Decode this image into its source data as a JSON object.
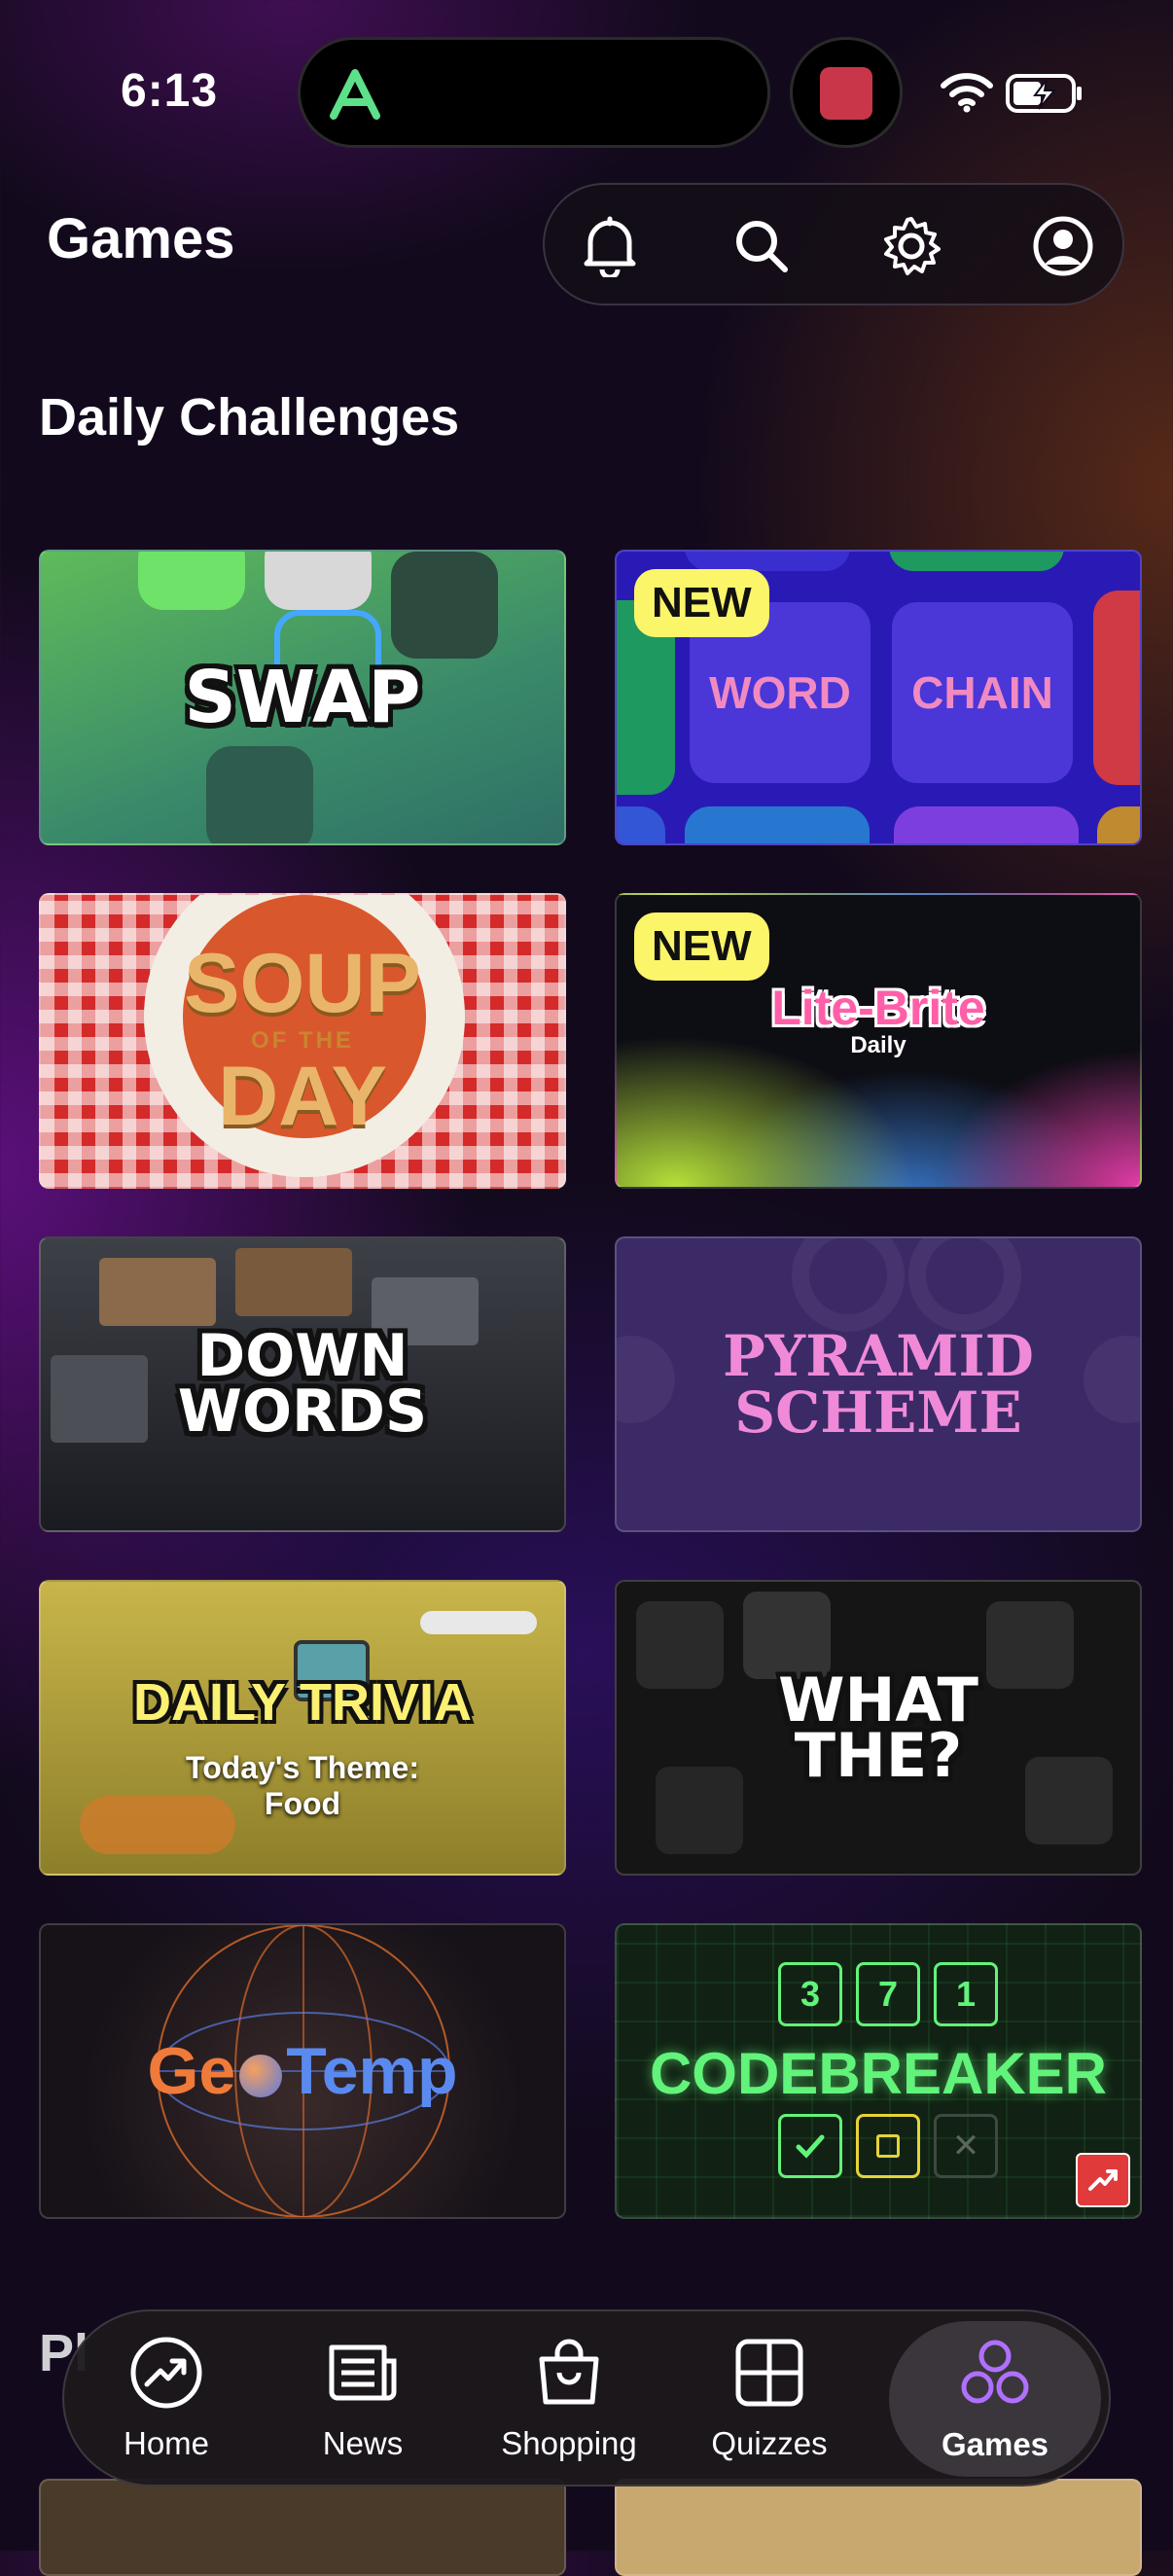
{
  "status_bar": {
    "time": "6:13"
  },
  "header": {
    "title": "Games"
  },
  "section": {
    "title": "Daily Challenges",
    "next_title_peek": "Pl"
  },
  "cards": {
    "swap": {
      "title": "SWAP"
    },
    "word_chain": {
      "badge": "NEW",
      "word1": "WORD",
      "word2": "CHAIN"
    },
    "soup": {
      "line1": "SOUP",
      "line2": "OF THE",
      "line3": "DAY"
    },
    "lite_brite": {
      "badge": "NEW",
      "title": "Lite-Brite",
      "subtitle": "Daily"
    },
    "down_words": {
      "line1": "DOWN",
      "line2": "WORDS"
    },
    "pyramid": {
      "line1": "PYRAMID",
      "line2": "SCHEME"
    },
    "trivia": {
      "title": "DAILY TRIVIA",
      "theme1": "Today's Theme:",
      "theme2": "Food"
    },
    "what_the": {
      "line1": "WHAT",
      "line2": "THE?"
    },
    "geotemp": {
      "part1": "Ge",
      "part2": "Temp"
    },
    "codebreaker": {
      "title": "CODEBREAKER",
      "digits": [
        "3",
        "7",
        "1"
      ]
    }
  },
  "tabs": [
    {
      "label": "Home",
      "icon": "trending-icon"
    },
    {
      "label": "News",
      "icon": "news-icon"
    },
    {
      "label": "Shopping",
      "icon": "shopping-bag-icon"
    },
    {
      "label": "Quizzes",
      "icon": "quizzes-grid-icon"
    },
    {
      "label": "Games",
      "icon": "games-icon",
      "active": true
    }
  ],
  "colors": {
    "accent_games": "#b070ff",
    "badge": "#fbf56a",
    "code_green": "#62f37a"
  }
}
